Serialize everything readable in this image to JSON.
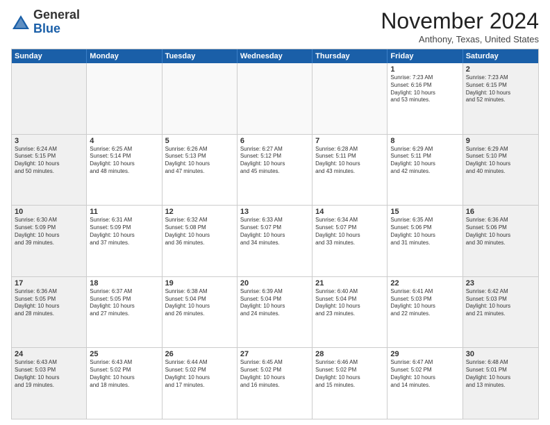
{
  "header": {
    "logo_general": "General",
    "logo_blue": "Blue",
    "month_title": "November 2024",
    "location": "Anthony, Texas, United States"
  },
  "days_of_week": [
    "Sunday",
    "Monday",
    "Tuesday",
    "Wednesday",
    "Thursday",
    "Friday",
    "Saturday"
  ],
  "rows": [
    [
      {
        "day": "",
        "empty": true
      },
      {
        "day": "",
        "empty": true
      },
      {
        "day": "",
        "empty": true
      },
      {
        "day": "",
        "empty": true
      },
      {
        "day": "",
        "empty": true
      },
      {
        "day": "1",
        "lines": [
          "Sunrise: 7:23 AM",
          "Sunset: 6:16 PM",
          "Daylight: 10 hours",
          "and 53 minutes."
        ]
      },
      {
        "day": "2",
        "lines": [
          "Sunrise: 7:23 AM",
          "Sunset: 6:15 PM",
          "Daylight: 10 hours",
          "and 52 minutes."
        ]
      }
    ],
    [
      {
        "day": "3",
        "lines": [
          "Sunrise: 6:24 AM",
          "Sunset: 5:15 PM",
          "Daylight: 10 hours",
          "and 50 minutes."
        ]
      },
      {
        "day": "4",
        "lines": [
          "Sunrise: 6:25 AM",
          "Sunset: 5:14 PM",
          "Daylight: 10 hours",
          "and 48 minutes."
        ]
      },
      {
        "day": "5",
        "lines": [
          "Sunrise: 6:26 AM",
          "Sunset: 5:13 PM",
          "Daylight: 10 hours",
          "and 47 minutes."
        ]
      },
      {
        "day": "6",
        "lines": [
          "Sunrise: 6:27 AM",
          "Sunset: 5:12 PM",
          "Daylight: 10 hours",
          "and 45 minutes."
        ]
      },
      {
        "day": "7",
        "lines": [
          "Sunrise: 6:28 AM",
          "Sunset: 5:11 PM",
          "Daylight: 10 hours",
          "and 43 minutes."
        ]
      },
      {
        "day": "8",
        "lines": [
          "Sunrise: 6:29 AM",
          "Sunset: 5:11 PM",
          "Daylight: 10 hours",
          "and 42 minutes."
        ]
      },
      {
        "day": "9",
        "lines": [
          "Sunrise: 6:29 AM",
          "Sunset: 5:10 PM",
          "Daylight: 10 hours",
          "and 40 minutes."
        ]
      }
    ],
    [
      {
        "day": "10",
        "lines": [
          "Sunrise: 6:30 AM",
          "Sunset: 5:09 PM",
          "Daylight: 10 hours",
          "and 39 minutes."
        ]
      },
      {
        "day": "11",
        "lines": [
          "Sunrise: 6:31 AM",
          "Sunset: 5:09 PM",
          "Daylight: 10 hours",
          "and 37 minutes."
        ]
      },
      {
        "day": "12",
        "lines": [
          "Sunrise: 6:32 AM",
          "Sunset: 5:08 PM",
          "Daylight: 10 hours",
          "and 36 minutes."
        ]
      },
      {
        "day": "13",
        "lines": [
          "Sunrise: 6:33 AM",
          "Sunset: 5:07 PM",
          "Daylight: 10 hours",
          "and 34 minutes."
        ]
      },
      {
        "day": "14",
        "lines": [
          "Sunrise: 6:34 AM",
          "Sunset: 5:07 PM",
          "Daylight: 10 hours",
          "and 33 minutes."
        ]
      },
      {
        "day": "15",
        "lines": [
          "Sunrise: 6:35 AM",
          "Sunset: 5:06 PM",
          "Daylight: 10 hours",
          "and 31 minutes."
        ]
      },
      {
        "day": "16",
        "lines": [
          "Sunrise: 6:36 AM",
          "Sunset: 5:06 PM",
          "Daylight: 10 hours",
          "and 30 minutes."
        ]
      }
    ],
    [
      {
        "day": "17",
        "lines": [
          "Sunrise: 6:36 AM",
          "Sunset: 5:05 PM",
          "Daylight: 10 hours",
          "and 28 minutes."
        ]
      },
      {
        "day": "18",
        "lines": [
          "Sunrise: 6:37 AM",
          "Sunset: 5:05 PM",
          "Daylight: 10 hours",
          "and 27 minutes."
        ]
      },
      {
        "day": "19",
        "lines": [
          "Sunrise: 6:38 AM",
          "Sunset: 5:04 PM",
          "Daylight: 10 hours",
          "and 26 minutes."
        ]
      },
      {
        "day": "20",
        "lines": [
          "Sunrise: 6:39 AM",
          "Sunset: 5:04 PM",
          "Daylight: 10 hours",
          "and 24 minutes."
        ]
      },
      {
        "day": "21",
        "lines": [
          "Sunrise: 6:40 AM",
          "Sunset: 5:04 PM",
          "Daylight: 10 hours",
          "and 23 minutes."
        ]
      },
      {
        "day": "22",
        "lines": [
          "Sunrise: 6:41 AM",
          "Sunset: 5:03 PM",
          "Daylight: 10 hours",
          "and 22 minutes."
        ]
      },
      {
        "day": "23",
        "lines": [
          "Sunrise: 6:42 AM",
          "Sunset: 5:03 PM",
          "Daylight: 10 hours",
          "and 21 minutes."
        ]
      }
    ],
    [
      {
        "day": "24",
        "lines": [
          "Sunrise: 6:43 AM",
          "Sunset: 5:03 PM",
          "Daylight: 10 hours",
          "and 19 minutes."
        ]
      },
      {
        "day": "25",
        "lines": [
          "Sunrise: 6:43 AM",
          "Sunset: 5:02 PM",
          "Daylight: 10 hours",
          "and 18 minutes."
        ]
      },
      {
        "day": "26",
        "lines": [
          "Sunrise: 6:44 AM",
          "Sunset: 5:02 PM",
          "Daylight: 10 hours",
          "and 17 minutes."
        ]
      },
      {
        "day": "27",
        "lines": [
          "Sunrise: 6:45 AM",
          "Sunset: 5:02 PM",
          "Daylight: 10 hours",
          "and 16 minutes."
        ]
      },
      {
        "day": "28",
        "lines": [
          "Sunrise: 6:46 AM",
          "Sunset: 5:02 PM",
          "Daylight: 10 hours",
          "and 15 minutes."
        ]
      },
      {
        "day": "29",
        "lines": [
          "Sunrise: 6:47 AM",
          "Sunset: 5:02 PM",
          "Daylight: 10 hours",
          "and 14 minutes."
        ]
      },
      {
        "day": "30",
        "lines": [
          "Sunrise: 6:48 AM",
          "Sunset: 5:01 PM",
          "Daylight: 10 hours",
          "and 13 minutes."
        ]
      }
    ]
  ]
}
